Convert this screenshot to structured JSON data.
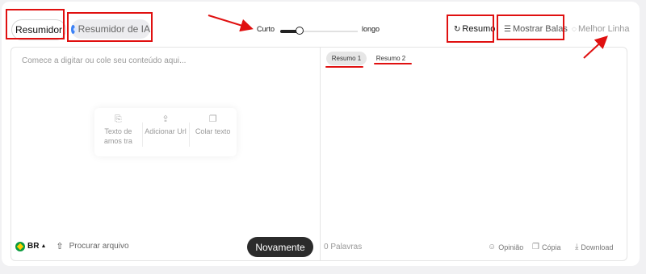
{
  "mode_tabs": {
    "summarizer": "Resumidor",
    "ai_summarizer": "Resumidor de IA"
  },
  "length": {
    "short": "Curto",
    "long": "longo",
    "value": 0.25
  },
  "output_modes": {
    "summary": "Resumo",
    "bullets": "Mostrar Balas",
    "best_line": "Melhor Linha"
  },
  "input": {
    "placeholder": "Comece a digitar ou cole seu conteúdo aqui...",
    "options": [
      {
        "label": "Texto de amos tra",
        "icon": "document-icon"
      },
      {
        "label": "Adicionar Url",
        "icon": "link-upload-icon"
      },
      {
        "label": "Colar texto",
        "icon": "clipboard-icon"
      }
    ],
    "language": "BR",
    "upload_label": "Procurar arquivo",
    "again_button": "Novamente"
  },
  "output": {
    "tabs": [
      "Resumo 1",
      "Resumo 2"
    ],
    "word_count": "0 Palavras",
    "actions": {
      "feedback": "Opinião",
      "copy": "Cópia",
      "download": "Download"
    }
  },
  "colors": {
    "annotation": "#e01010",
    "accent_dark": "#2b2b2b",
    "flag_green": "#0a9a3e"
  }
}
